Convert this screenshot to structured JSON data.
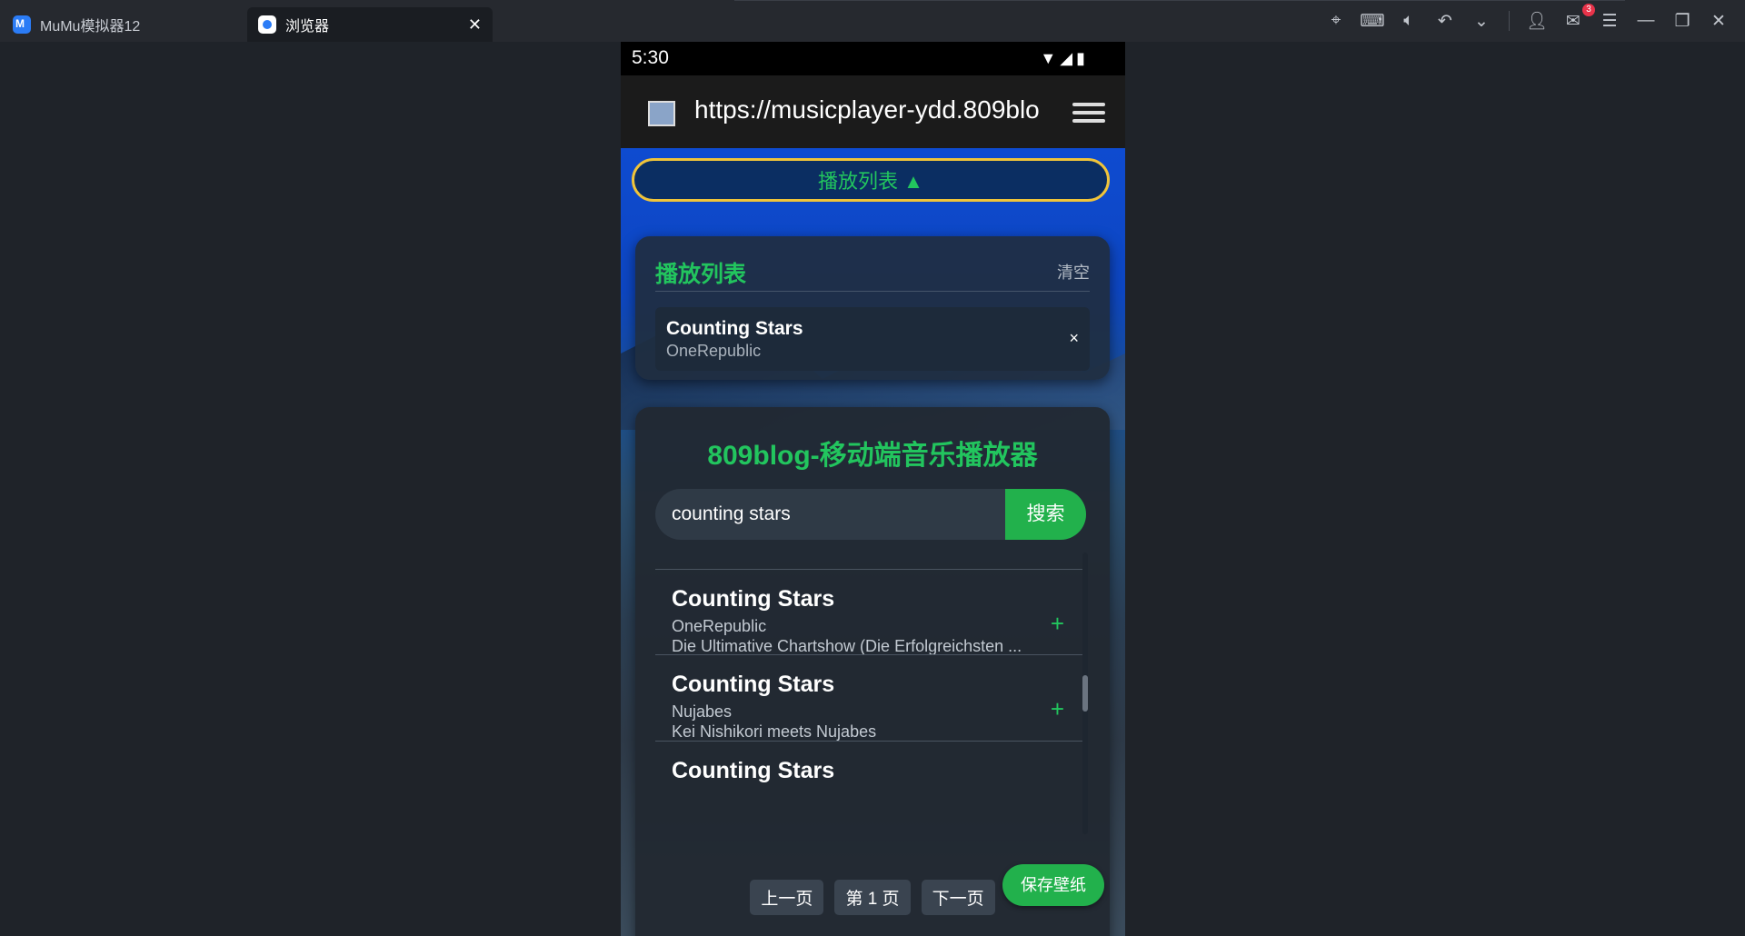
{
  "window": {
    "tabs": [
      {
        "label": "MuMu模拟器12"
      },
      {
        "label": "浏览器",
        "close": "✕"
      }
    ],
    "notification_count": "3",
    "icons": [
      "location-icon",
      "keyboard-icon",
      "volume-icon",
      "undo-icon",
      "chevron-down-icon",
      "user-icon",
      "mail-icon",
      "menu-icon",
      "minimize-icon",
      "restore-icon",
      "close-icon"
    ]
  },
  "status_bar": {
    "time": "5:30"
  },
  "browser": {
    "url": "https://musicplayer-ydd.809blo"
  },
  "page": {
    "toggle_label": "播放列表 ▲",
    "playlist": {
      "title": "播放列表",
      "clear_label": "清空",
      "items": [
        {
          "title": "Counting Stars",
          "artist": "OneRepublic",
          "remove": "×"
        }
      ]
    },
    "app_title": "809blog-移动端音乐播放器",
    "search": {
      "value": "counting stars",
      "button": "搜索"
    },
    "results": [
      {
        "title": "Counting Stars",
        "artist": "OneRepublic",
        "album": "Die Ultimative Chartshow (Die Erfolgreichsten ...",
        "add": "+"
      },
      {
        "title": "Counting Stars",
        "artist": "Nujabes",
        "album": "Kei Nishikori meets Nujabes",
        "add": "+"
      },
      {
        "title": "Counting Stars",
        "artist": "",
        "album": "",
        "add": ""
      }
    ],
    "pager": {
      "prev": "上一页",
      "current": "第 1 页",
      "next": "下一页"
    },
    "save_wallpaper": "保存壁纸"
  }
}
